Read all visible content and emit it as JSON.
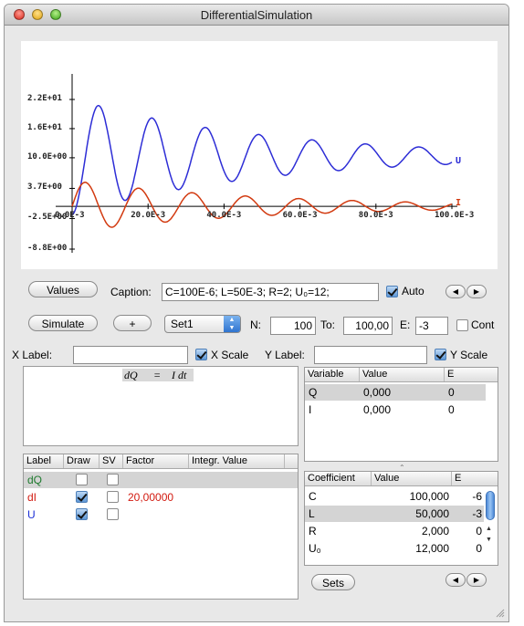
{
  "window": {
    "title": "DifferentialSimulation"
  },
  "chart_data": {
    "type": "line",
    "x_range": [
      0.0,
      0.1
    ],
    "y_range": [
      -8.8,
      22
    ],
    "x_tick_labels": [
      "0.0E-3",
      "20.0E-3",
      "40.0E-3",
      "60.0E-3",
      "80.0E-3",
      "100.0E-3"
    ],
    "y_tick_labels": [
      "2.2E+01",
      "1.6E+01",
      "10.0E+00",
      "3.7E+00",
      "-2.5E+00",
      "-8.8E+00"
    ],
    "series": [
      {
        "name": "U",
        "color": "#2d2dd6",
        "final_value": 10.3,
        "amplitude": 12,
        "decay_per_s": 20,
        "omega_rad_per_s": 447
      },
      {
        "name": "I",
        "color": "#d23a10",
        "final_value": 0,
        "amplitude": 5.3,
        "decay_per_s": 20,
        "omega_rad_per_s": 447
      }
    ]
  },
  "controls": {
    "values_button": "Values",
    "caption_label": "Caption:",
    "caption_value": "C=100E-6; L=50E-3; R=2; U₀=12;",
    "auto_label": "Auto",
    "simulate_button": "Simulate",
    "plus_button": "+",
    "set_value": "Set1",
    "n_label": "N:",
    "n_value": "100",
    "to_label": "To:",
    "to_value": "100,00",
    "e_label": "E:",
    "e_value": "-3",
    "cont_label": "Cont",
    "xlabel_label": "X Label:",
    "xscale_label": "X Scale",
    "ylabel_label": "Y Label:",
    "yscale_label": "Y Scale",
    "sets_button": "Sets"
  },
  "equation": {
    "lhs": "dQ",
    "eq": "=",
    "rhs": "I dt"
  },
  "variables": {
    "headers": [
      "Variable",
      "Value",
      "E"
    ],
    "rows": [
      {
        "name": "Q",
        "value": "0,000",
        "e": "0"
      },
      {
        "name": "I",
        "value": "0,000",
        "e": "0"
      }
    ]
  },
  "labels_table": {
    "headers": [
      "Label",
      "Draw",
      "SV",
      "Factor",
      "Integr. Value"
    ],
    "rows": [
      {
        "label": "dQ",
        "color": "#1e7a2e",
        "draw": false,
        "sv": false,
        "factor": ""
      },
      {
        "label": "dI",
        "color": "#d21a10",
        "draw": true,
        "sv": false,
        "factor": "20,00000"
      },
      {
        "label": "U",
        "color": "#1b2fd6",
        "draw": true,
        "sv": false,
        "factor": ""
      }
    ]
  },
  "coefficients": {
    "headers": [
      "Coefficient",
      "Value",
      "E"
    ],
    "rows": [
      {
        "name": "C",
        "value": "100,000",
        "e": "-6"
      },
      {
        "name": "L",
        "value": "50,000",
        "e": "-3"
      },
      {
        "name": "R",
        "value": "2,000",
        "e": "0"
      },
      {
        "name": "U₀",
        "value": "12,000",
        "e": "0"
      }
    ]
  }
}
